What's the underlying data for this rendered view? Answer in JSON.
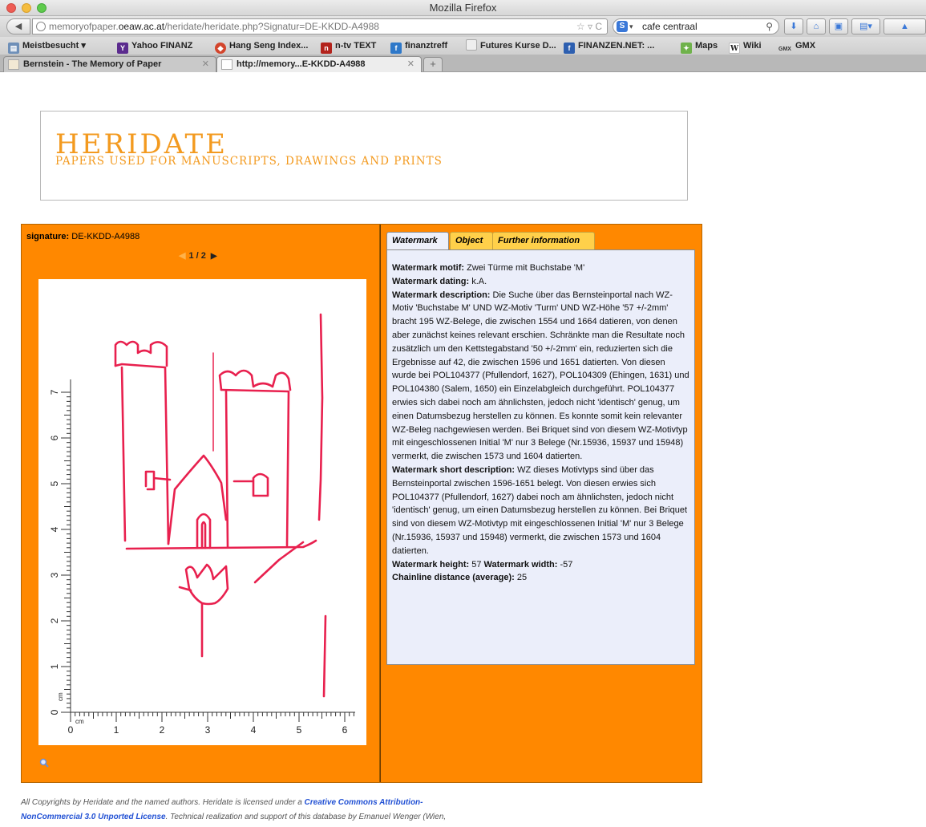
{
  "browser": {
    "window_title": "Mozilla Firefox",
    "url_prefix": "memoryofpaper.",
    "url_host": "oeaw.ac.at",
    "url_path": "/heridate/heridate.php?Signatur=DE-KKDD-A4988",
    "search_value": "cafe centraal",
    "bookmarks": [
      {
        "label": "Meistbesucht ▾",
        "color": "#6e8fb8"
      },
      {
        "label": "Yahoo FINANZ",
        "color": "#5b2b8e"
      },
      {
        "label": "Hang Seng Index...",
        "color": "#d3452c"
      },
      {
        "label": "n-tv TEXT",
        "color": "#b3231c"
      },
      {
        "label": "finanztreff",
        "color": "#2e78c9"
      },
      {
        "label": "Futures Kurse D...",
        "color": "#eeeeee"
      },
      {
        "label": "FINANZEN.NET: ...",
        "color": "#2d5fb0"
      },
      {
        "label": "Maps",
        "color": "#6fb24b"
      },
      {
        "label": "Wiki",
        "color": "#ffffff"
      },
      {
        "label": "GMX",
        "color": "#ffffff"
      }
    ],
    "tabs": [
      {
        "label": "Bernstein - The Memory of Paper",
        "active": false
      },
      {
        "label": "http://memory...E-KKDD-A4988",
        "active": true
      }
    ],
    "new_tab": "+"
  },
  "banner": {
    "title": "HERIDATE",
    "subtitle": "PAPERS USED FOR MANUSCRIPTS, DRAWINGS AND PRINTS",
    "accent_color": "#f39a1f"
  },
  "left": {
    "signature_label": "signature:",
    "signature_value": "DE-KKDD-A4988",
    "pager": "1 / 2",
    "ruler": {
      "unit": "cm",
      "vertical_ticks": [
        "0",
        "1",
        "2",
        "3",
        "4",
        "5",
        "6",
        "7"
      ],
      "horizontal_ticks": [
        "0",
        "1",
        "2",
        "3",
        "4",
        "5",
        "6"
      ]
    }
  },
  "right": {
    "tabs": [
      "Watermark",
      "Object",
      "Further information"
    ],
    "active_tab": "Watermark",
    "motif_label": "Watermark motif:",
    "motif": "Zwei Türme mit Buchstabe 'M'",
    "dating_label": "Watermark dating:",
    "dating": "k.A.",
    "description_label": "Watermark description:",
    "description": "Die Suche über das Bernsteinportal nach WZ-Motiv 'Buchstabe M' UND WZ-Motiv 'Turm' UND WZ-Höhe '57 +/-2mm' bracht 195 WZ-Belege, die zwischen 1554 und 1664 datieren, von denen aber zunächst keines relevant erschien. Schränkte man die Resultate noch zusätzlich um den Kettstegabstand '50 +/-2mm' ein, reduzierten sich die Ergebnisse auf 42, die zwischen 1596 und 1651 datierten. Von diesen wurde bei POL104377 (Pfullendorf, 1627), POL104309 (Ehingen, 1631) und POL104380 (Salem, 1650) ein Einzelabgleich durchgeführt. POL104377 erwies sich dabei noch am ähnlichsten, jedoch nicht 'identisch' genug, um einen Datumsbezug herstellen zu können. Es konnte somit kein relevanter WZ-Beleg nachgewiesen werden. Bei Briquet sind von diesem WZ-Motivtyp mit eingeschlossenen Initial 'M' nur 3 Belege (Nr.15936, 15937 und 15948) vermerkt, die zwischen 1573 und 1604 datierten.",
    "short_label": "Watermark short description:",
    "short": "WZ dieses Motivtyps sind über das Bernsteinportal zwischen 1596-1651 belegt. Von diesen erwies sich POL104377 (Pfullendorf, 1627) dabei noch am ähnlichsten, jedoch nicht 'identisch' genug, um einen Datumsbezug herstellen zu können. Bei Briquet sind von diesem WZ-Motivtyp mit eingeschlossenen Initial 'M' nur 3 Belege (Nr.15936, 15937 und 15948) vermerkt, die zwischen 1573 und 1604 datierten.",
    "height_label": "Watermark height:",
    "height": "57",
    "width_label": "Watermark width:",
    "width": "-57",
    "chain_label": "Chainline distance (average):",
    "chain": "25"
  },
  "footer": {
    "text1": "All Copyrights by Heridate and the named authors. Heridate is licensed under a ",
    "link1": "Creative Commons Attribution-",
    "link2": "NonCommercial 3.0 Unported License",
    "text2": ". Technical realization and support of this database by Emanuel Wenger (Wien,"
  },
  "colors": {
    "panel_orange": "#ff8800",
    "tab_yellow": "#ffd04a",
    "info_bg": "#ebeefa",
    "tracing_red": "#e8204e"
  }
}
